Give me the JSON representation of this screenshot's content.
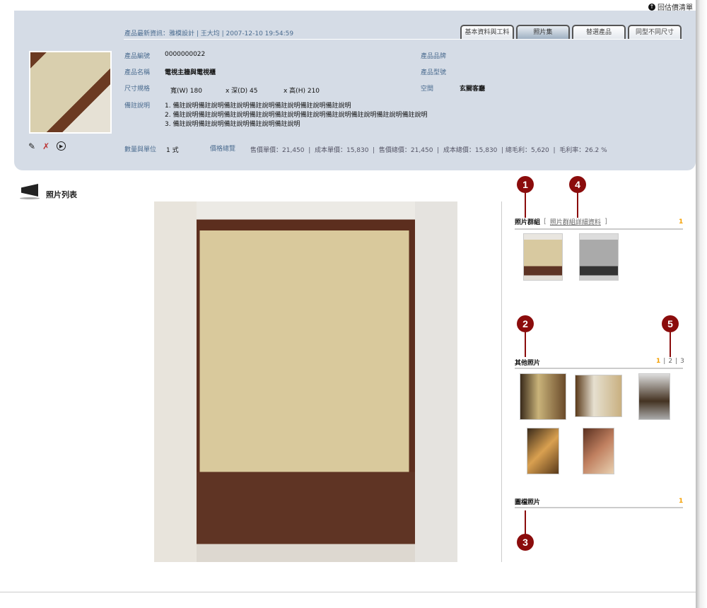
{
  "top_link": {
    "label": "回估價清單",
    "icon": "arrow-up-circle-icon"
  },
  "header": {
    "news": "產品最新資訊：雅模設計 | 王大均 | 2007-12-10  19:54:59",
    "tabs": [
      {
        "label": "基本資料與工料"
      },
      {
        "label": "照片集",
        "active": true
      },
      {
        "label": "替選產品"
      },
      {
        "label": "同型不同尺寸"
      }
    ],
    "fields": {
      "code_label": "產品編號",
      "code": "0000000022",
      "name_label": "產品名稱",
      "name": "電視主牆與電視櫃",
      "size_label": "尺寸規格",
      "width": "寬(W)  180",
      "depth": "x 深(D) 45",
      "height": "x 高(H) 210",
      "brand_label": "產品品牌",
      "model_label": "產品型號",
      "space_label": "空間",
      "space": "玄關客廳",
      "notes_label": "備註說明",
      "notes": [
        "1. 備註說明備註說明備註說明備註說明備註說明備註說明備註說明",
        "2. 備註說明備註說明備註說明備註說明備註說明備註說明備註說明備註說明備註說明備註說明",
        "3. 備註說明備註說明備註說明備註說明備註說明"
      ],
      "qty_label": "數量與單位",
      "qty": "1 式",
      "price_label": "價格總覽",
      "price": "售價單價：21,450  |  成本單價：15,830  |  售價總價：21,450  |  成本總價：15,830  | 總毛利：5,620  |  毛利率：26.2 %"
    },
    "tools": [
      "pen-icon",
      "no-edit-icon",
      "play-circle-icon"
    ]
  },
  "photo_list": {
    "title": "照片列表",
    "icon": "megaphone-icon"
  },
  "sidebar": {
    "group": {
      "title": "照片群組",
      "link": "照片群組詳細資料",
      "open": "[",
      "close": "]",
      "pages": [
        "1"
      ]
    },
    "other": {
      "title": "其他照片",
      "pages": [
        "1",
        "2",
        "3"
      ],
      "sep": "|"
    },
    "files": {
      "title": "圖檔照片",
      "pages": [
        "1"
      ]
    }
  },
  "callouts": [
    "1",
    "2",
    "3",
    "4",
    "5"
  ],
  "colors": {
    "panel": "#d5dce6",
    "label": "#4a6b8f",
    "accent": "#f5a000",
    "callout": "#8b0c0c"
  }
}
